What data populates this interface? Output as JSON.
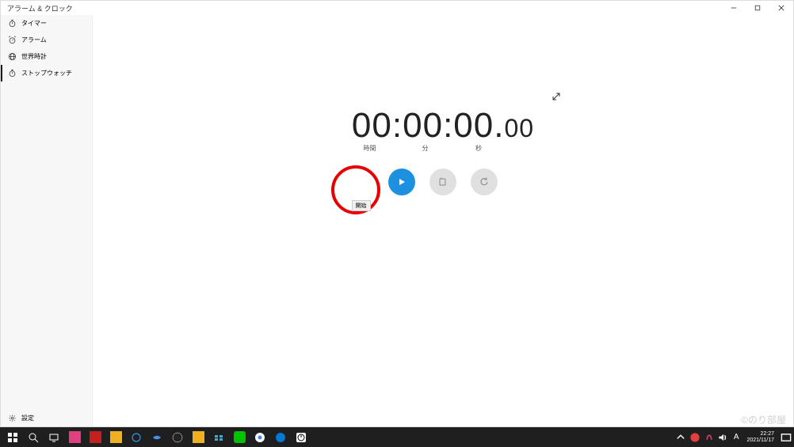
{
  "app": {
    "title": "アラーム & クロック"
  },
  "sidebar": {
    "items": [
      {
        "label": "タイマー",
        "icon": "timer"
      },
      {
        "label": "アラーム",
        "icon": "alarm"
      },
      {
        "label": "世界時計",
        "icon": "world-clock"
      },
      {
        "label": "ストップウォッチ",
        "icon": "stopwatch",
        "active": true
      }
    ],
    "settings_label": "設定"
  },
  "stopwatch": {
    "hours": "00",
    "minutes": "00",
    "seconds": "00",
    "fraction": "00",
    "label_hours": "時間",
    "label_minutes": "分",
    "label_seconds": "秒",
    "start_tooltip": "開始"
  },
  "colors": {
    "primary": "#1e90e0",
    "annotation": "#e80000"
  },
  "watermark": "©のり部屋",
  "taskbar": {
    "time": "22:27",
    "date": "2021/11/17",
    "ime": "A"
  }
}
